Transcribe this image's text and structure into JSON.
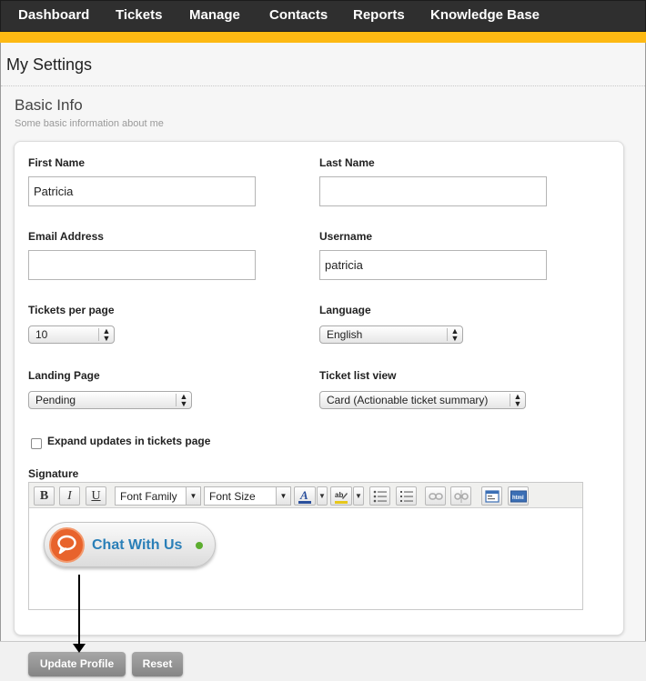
{
  "nav": {
    "items": [
      {
        "label": "Dashboard"
      },
      {
        "label": "Tickets"
      },
      {
        "label": "Manage"
      },
      {
        "label": "Contacts"
      },
      {
        "label": "Reports"
      },
      {
        "label": "Knowledge Base"
      }
    ]
  },
  "page": {
    "title": "My Settings",
    "section_title": "Basic Info",
    "section_subtitle": "Some basic information about me"
  },
  "form": {
    "first_name": {
      "label": "First Name",
      "value": "Patricia"
    },
    "last_name": {
      "label": "Last Name",
      "value": ""
    },
    "email": {
      "label": "Email Address",
      "value": ""
    },
    "username": {
      "label": "Username",
      "value": "patricia"
    },
    "tickets_per_page": {
      "label": "Tickets per page",
      "value": "10"
    },
    "language": {
      "label": "Language",
      "value": "English"
    },
    "landing_page": {
      "label": "Landing Page",
      "value": "Pending"
    },
    "ticket_list_view": {
      "label": "Ticket list view",
      "value": "Card (Actionable ticket summary)"
    },
    "expand_updates": {
      "label": "Expand updates in tickets page",
      "checked": false
    },
    "signature": {
      "label": "Signature"
    }
  },
  "editor": {
    "bold": "B",
    "italic": "I",
    "underline": "U",
    "font_family": "Font Family",
    "font_size": "Font Size",
    "chat_button_text": "Chat With Us"
  },
  "actions": {
    "update": "Update Profile",
    "reset": "Reset"
  },
  "colors": {
    "nav_bg": "#2f2f2f",
    "accent": "#fdb913",
    "chat_orange": "#e8632c",
    "chat_blue": "#2a7fb8",
    "status_green": "#5cad2f"
  }
}
